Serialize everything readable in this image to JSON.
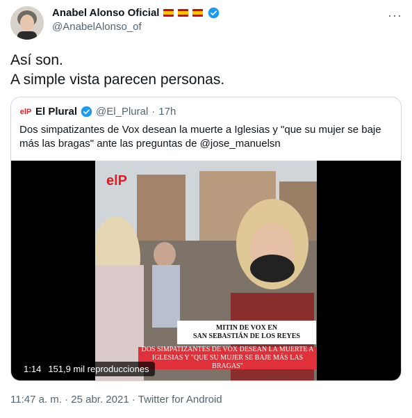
{
  "tweet": {
    "author_name": "Anabel Alonso Oficial",
    "author_handle": "@AnabelAlonso_of",
    "text_line1": "Así son.",
    "text_line2": "A simple vista parecen personas.",
    "more_icon": "more-icon",
    "timestamp": "11:47 a. m. · 25 abr. 2021 · Twitter for Android"
  },
  "quoted": {
    "logo_text": "elP",
    "name": "El Plural",
    "handle": "@El_Plural",
    "separator": "·",
    "time": "17h",
    "text": "Dos simpatizantes de Vox desean la muerte a Iglesias y \"que su mujer se baje más las bragas\" ante las preguntas de @jose_manuelsn",
    "video": {
      "logo_overlay": "elP",
      "caption1_line1": "MITIN DE VOX EN",
      "caption1_line2": "SAN SEBASTIÁN DE LOS REYES",
      "caption2_line1": "DOS SIMPATIZANTES DE VOX DESEAN LA MUERTE A",
      "caption2_line2": "IGLESIAS Y \"QUE SU MUJER SE BAJE MÁS LAS BRAGAS\"",
      "duration": "1:14",
      "views": "151,9 mil reproducciones"
    }
  },
  "colors": {
    "verified": "#1d9bf0",
    "secondary_text": "#536471",
    "brand_red": "#e31b23"
  }
}
